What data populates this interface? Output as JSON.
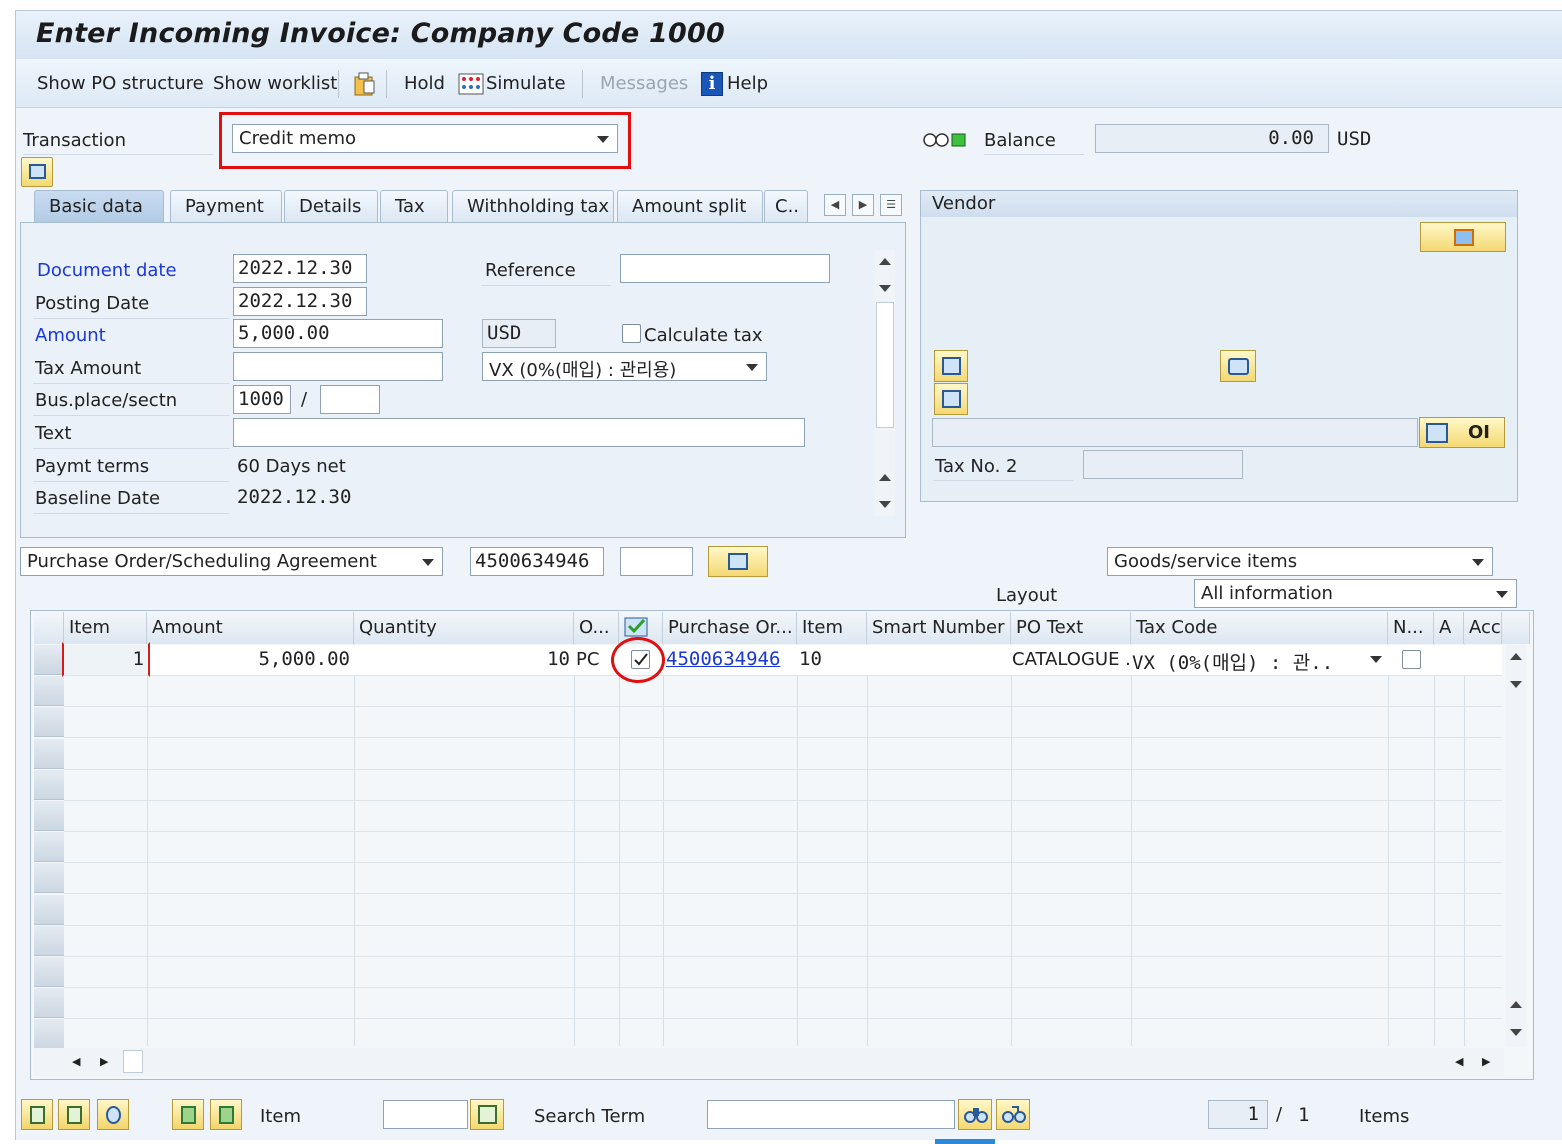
{
  "window": {
    "title": "Enter Incoming Invoice: Company Code 1000"
  },
  "toolbar": {
    "show_po_structure": "Show PO structure",
    "show_worklist": "Show worklist",
    "hold": "Hold",
    "simulate": "Simulate",
    "messages": "Messages",
    "help": "Help"
  },
  "header": {
    "transaction_label": "Transaction",
    "transaction_value": "Credit memo",
    "balance_label": "Balance",
    "balance_value": "0.00",
    "balance_currency": "USD"
  },
  "tabs": [
    "Basic data",
    "Payment",
    "Details",
    "Tax",
    "Withholding tax",
    "Amount split",
    "C.."
  ],
  "basic_data": {
    "document_date_label": "Document date",
    "document_date": "2022.12.30",
    "posting_date_label": "Posting Date",
    "posting_date": "2022.12.30",
    "amount_label": "Amount",
    "amount": "5,000.00",
    "currency": "USD",
    "tax_amount_label": "Tax Amount",
    "tax_amount": "",
    "calculate_tax_label": "Calculate tax",
    "calculate_tax_checked": false,
    "tax_code": "VX (0%(매입) : 관리용)",
    "bus_place_label": "Bus.place/sectn",
    "bus_place": "1000",
    "bus_place_sep": "/",
    "section": "",
    "text_label": "Text",
    "text": "",
    "reference_label": "Reference",
    "reference": "",
    "paymt_terms_label": "Paymt terms",
    "paymt_terms": "60 Days net",
    "baseline_date_label": "Baseline Date",
    "baseline_date": "2022.12.30"
  },
  "vendor": {
    "title": "Vendor",
    "oi_label": "OI",
    "tax_no2_label": "Tax No. 2",
    "tax_no2": ""
  },
  "reference_doc": {
    "type": "Purchase Order/Scheduling Agreement",
    "number": "4500634946",
    "extra": "",
    "item_view": "Goods/service items",
    "layout_label": "Layout",
    "layout_value": "All information"
  },
  "grid": {
    "columns": [
      "Item",
      "Amount",
      "Quantity",
      "O...",
      "",
      "Purchase Or...",
      "Item",
      "Smart Number",
      "PO Text",
      "Tax Code",
      "N...",
      "A",
      "Acc"
    ],
    "rows": [
      {
        "item": "1",
        "amount": "5,000.00",
        "quantity": "10",
        "unit": "PC",
        "selected": true,
        "po_number": "4500634946",
        "po_item": "10",
        "smart_number": "",
        "po_text": "CATALOGUE ..",
        "tax_code": "VX (0%(매입) : 관..",
        "n_checked": false
      }
    ]
  },
  "footer": {
    "item_label": "Item",
    "item_value": "",
    "search_term_label": "Search Term",
    "search_term_value": "",
    "page_current": "1",
    "page_sep": "/",
    "page_total": "1",
    "items_label": "Items"
  },
  "colors": {
    "highlight": "#e01010",
    "label_required": "#1a38d8"
  }
}
